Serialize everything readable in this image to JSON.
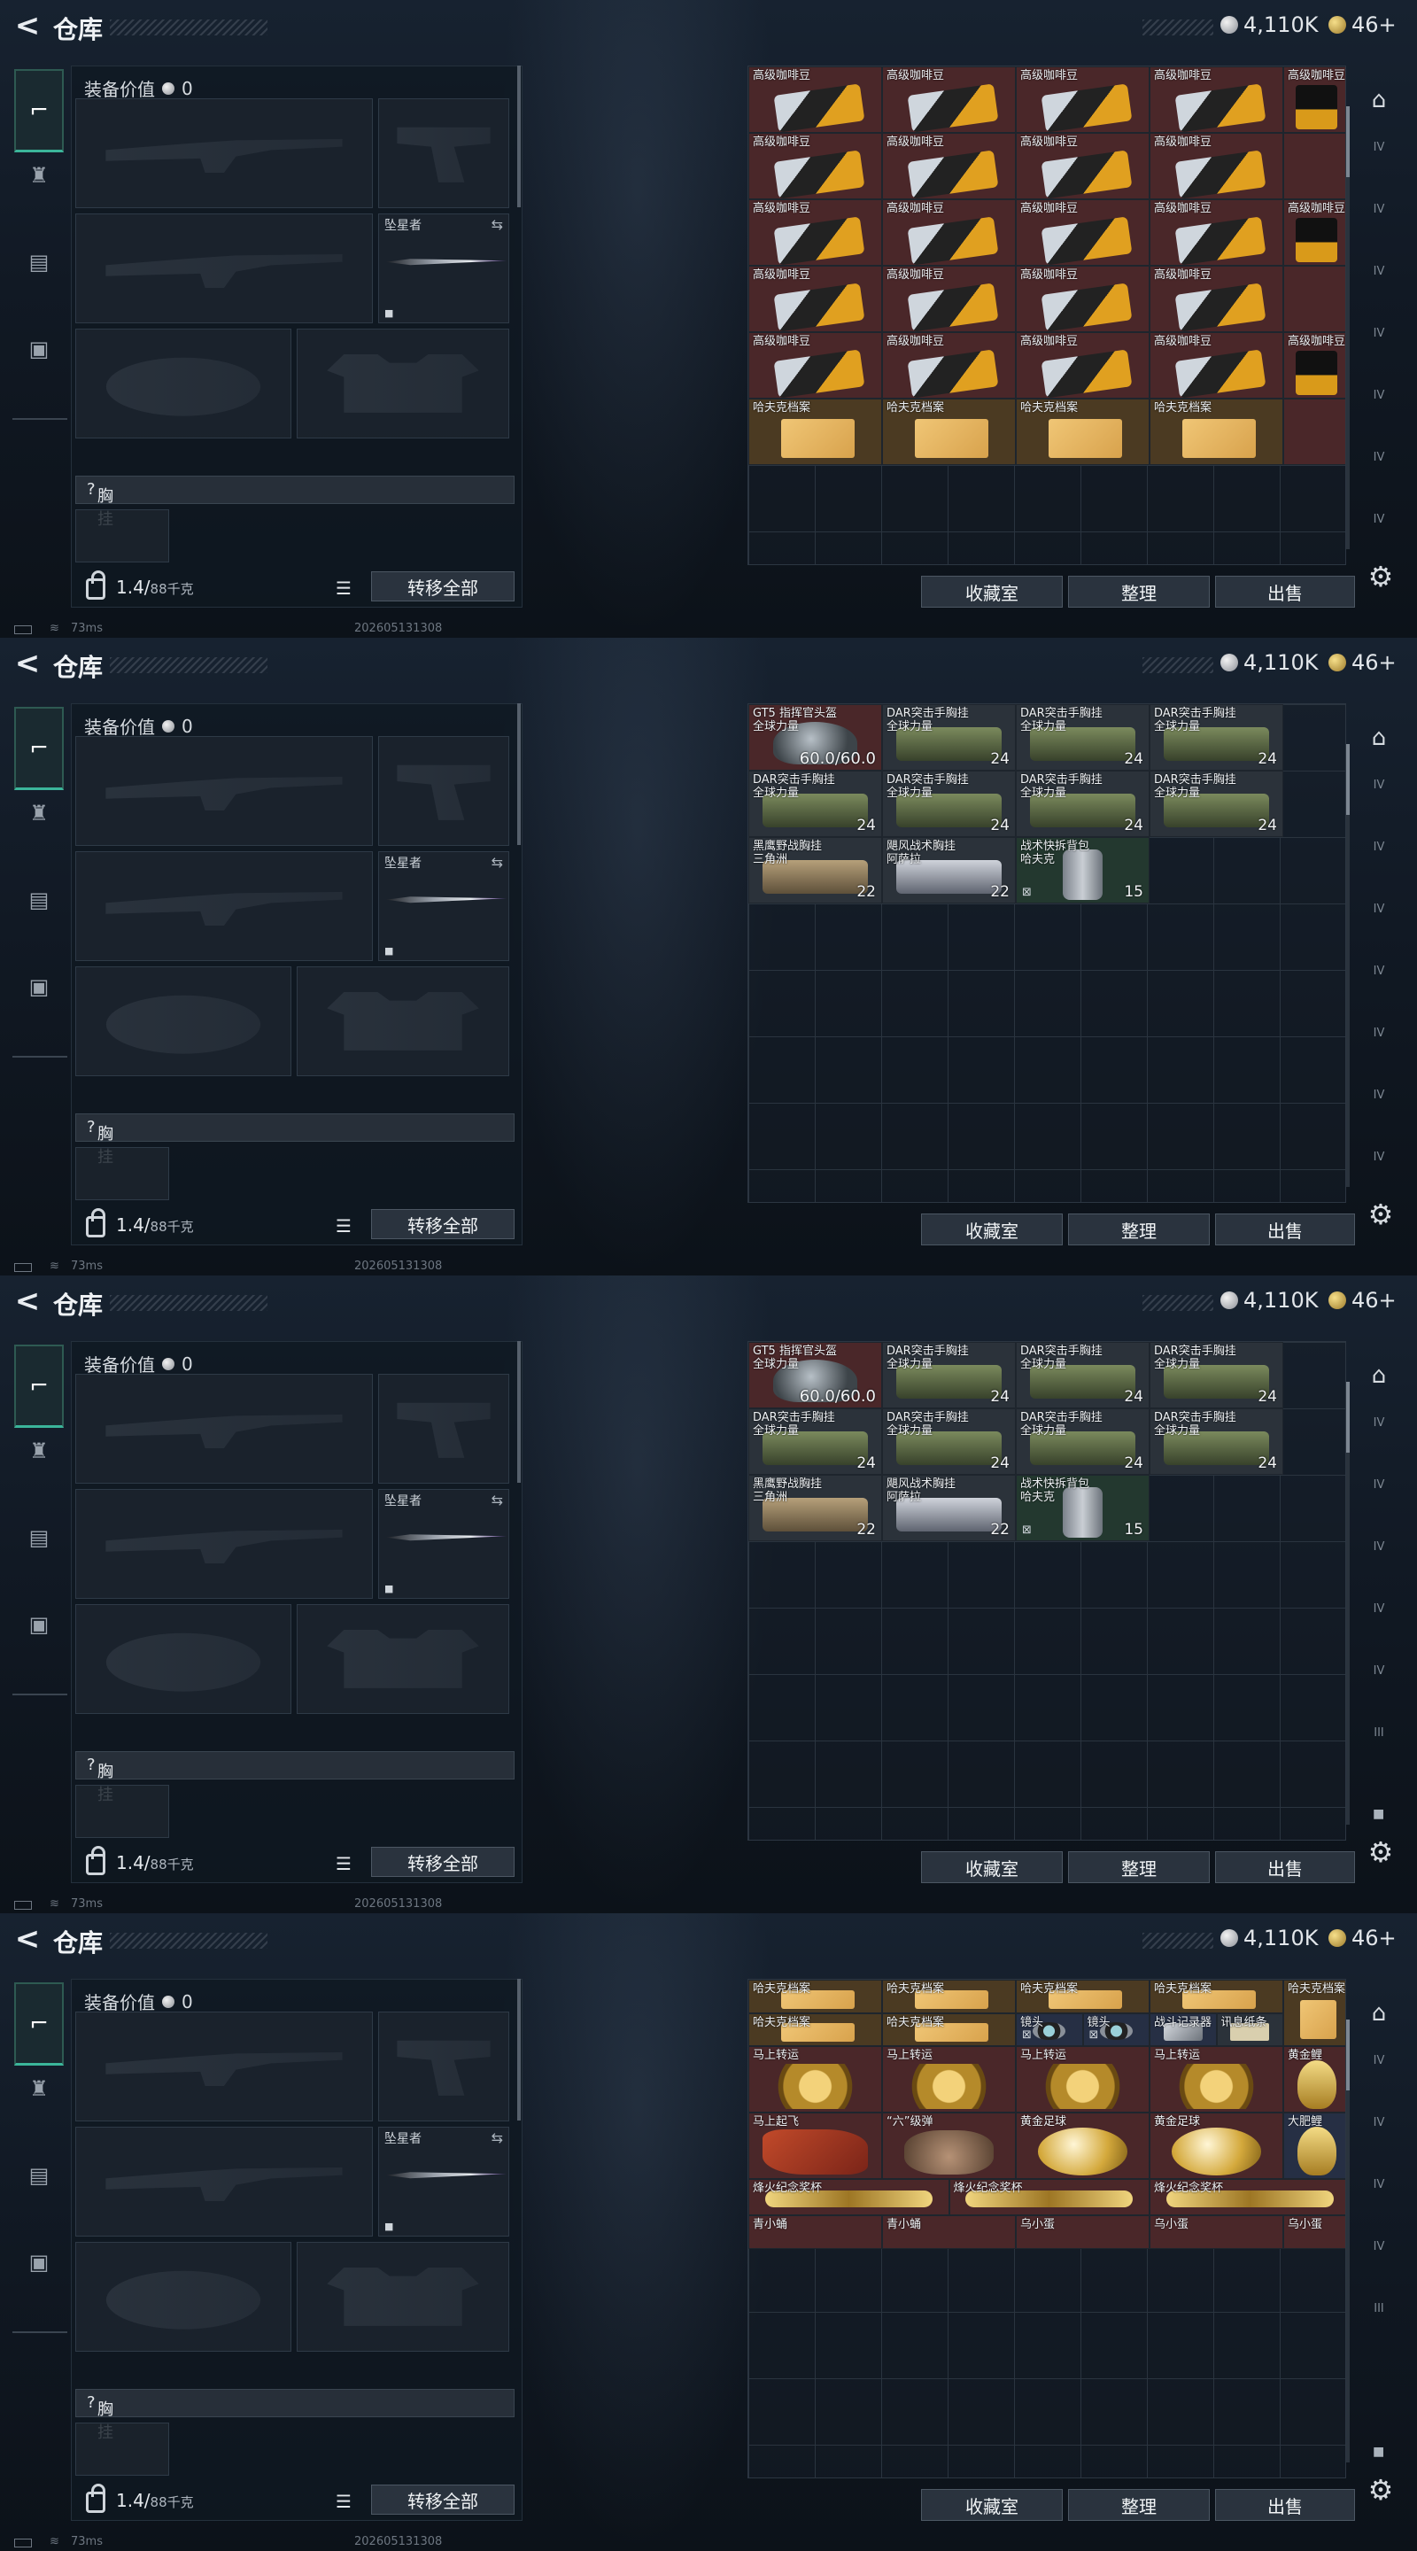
{
  "header": {
    "title": "仓库",
    "currency_silver": "4,110K",
    "currency_gold": "46+"
  },
  "left": {
    "equip_value_label": "装备价值",
    "equip_value": "0",
    "knife_name": "坠星者",
    "chest_label": "胸挂",
    "chest_help": "?",
    "weight_value": "1.4/",
    "weight_cap": "88千克",
    "transfer_all": "转移全部"
  },
  "buttons": {
    "collection": "收藏室",
    "organize": "整理",
    "sell": "出售"
  },
  "status": {
    "ping": "73ms",
    "datetime": "202605131308"
  },
  "right_rail": {
    "tabs": [
      "IV",
      "IV",
      "IV",
      "IV",
      "IV",
      "IV",
      "IV"
    ],
    "tabs_screen3": [
      "IV",
      "IV",
      "IV",
      "IV",
      "IV",
      "III"
    ],
    "tabs_screen4": [
      "IV",
      "IV",
      "IV",
      "IV",
      "III"
    ]
  },
  "screens": [
    {
      "cells": [
        {
          "c": 0,
          "r": -1,
          "w": 1,
          "h": 1,
          "bg": "bg-red",
          "name": "",
          "pic": "coffee"
        },
        {
          "c": 1,
          "r": -1,
          "w": 1,
          "h": 1,
          "bg": "bg-red",
          "name": "",
          "pic": "coffee"
        },
        {
          "c": 2,
          "r": -1,
          "w": 1,
          "h": 1,
          "bg": "bg-red",
          "name": "",
          "pic": "coffee"
        },
        {
          "c": 3,
          "r": -1,
          "w": 1,
          "h": 1,
          "bg": "bg-red",
          "name": "",
          "pic": "coffee"
        },
        {
          "c": 4,
          "r": -1,
          "w": 1,
          "h": 1,
          "bg": "bg-red",
          "name": "",
          "pic": "coffee"
        },
        {
          "c": 0,
          "r": 0,
          "w": 1,
          "h": 1,
          "bg": "bg-red",
          "name": "高级咖啡豆",
          "pic": "coffee"
        },
        {
          "c": 1,
          "r": 0,
          "w": 1,
          "h": 1,
          "bg": "bg-red",
          "name": "高级咖啡豆",
          "pic": "coffee"
        },
        {
          "c": 2,
          "r": 0,
          "w": 1,
          "h": 1,
          "bg": "bg-red",
          "name": "高级咖啡豆",
          "pic": "coffee"
        },
        {
          "c": 3,
          "r": 0,
          "w": 1,
          "h": 1,
          "bg": "bg-red",
          "name": "高级咖啡豆",
          "pic": "coffee"
        },
        {
          "c": 4,
          "r": 0,
          "w": 0.5,
          "h": 1,
          "bg": "bg-red",
          "name": "高级咖啡豆",
          "pic": "bag"
        },
        {
          "c": 0,
          "r": 1,
          "w": 1,
          "h": 1,
          "bg": "bg-red",
          "name": "高级咖啡豆",
          "pic": "coffee"
        },
        {
          "c": 1,
          "r": 1,
          "w": 1,
          "h": 1,
          "bg": "bg-red",
          "name": "高级咖啡豆",
          "pic": "coffee"
        },
        {
          "c": 2,
          "r": 1,
          "w": 1,
          "h": 1,
          "bg": "bg-red",
          "name": "高级咖啡豆",
          "pic": "coffee"
        },
        {
          "c": 3,
          "r": 1,
          "w": 1,
          "h": 1,
          "bg": "bg-red",
          "name": "高级咖啡豆",
          "pic": "coffee"
        },
        {
          "c": 4,
          "r": 1,
          "w": 0.5,
          "h": 1,
          "bg": "bg-red",
          "name": "",
          "pic": ""
        },
        {
          "c": 0,
          "r": 2,
          "w": 1,
          "h": 1,
          "bg": "bg-red",
          "name": "高级咖啡豆",
          "pic": "coffee"
        },
        {
          "c": 1,
          "r": 2,
          "w": 1,
          "h": 1,
          "bg": "bg-red",
          "name": "高级咖啡豆",
          "pic": "coffee"
        },
        {
          "c": 2,
          "r": 2,
          "w": 1,
          "h": 1,
          "bg": "bg-red",
          "name": "高级咖啡豆",
          "pic": "coffee"
        },
        {
          "c": 3,
          "r": 2,
          "w": 1,
          "h": 1,
          "bg": "bg-red",
          "name": "高级咖啡豆",
          "pic": "coffee"
        },
        {
          "c": 4,
          "r": 2,
          "w": 0.5,
          "h": 1,
          "bg": "bg-red",
          "name": "高级咖啡豆",
          "pic": "bag"
        },
        {
          "c": 0,
          "r": 3,
          "w": 1,
          "h": 1,
          "bg": "bg-red",
          "name": "高级咖啡豆",
          "pic": "coffee"
        },
        {
          "c": 1,
          "r": 3,
          "w": 1,
          "h": 1,
          "bg": "bg-red",
          "name": "高级咖啡豆",
          "pic": "coffee"
        },
        {
          "c": 2,
          "r": 3,
          "w": 1,
          "h": 1,
          "bg": "bg-red",
          "name": "高级咖啡豆",
          "pic": "coffee"
        },
        {
          "c": 3,
          "r": 3,
          "w": 1,
          "h": 1,
          "bg": "bg-red",
          "name": "高级咖啡豆",
          "pic": "coffee"
        },
        {
          "c": 4,
          "r": 3,
          "w": 0.5,
          "h": 1,
          "bg": "bg-red",
          "name": "",
          "pic": ""
        },
        {
          "c": 0,
          "r": 4,
          "w": 1,
          "h": 1,
          "bg": "bg-red",
          "name": "高级咖啡豆",
          "pic": "coffee"
        },
        {
          "c": 1,
          "r": 4,
          "w": 1,
          "h": 1,
          "bg": "bg-red",
          "name": "高级咖啡豆",
          "pic": "coffee"
        },
        {
          "c": 2,
          "r": 4,
          "w": 1,
          "h": 1,
          "bg": "bg-red",
          "name": "高级咖啡豆",
          "pic": "coffee"
        },
        {
          "c": 3,
          "r": 4,
          "w": 1,
          "h": 1,
          "bg": "bg-red",
          "name": "高级咖啡豆",
          "pic": "coffee"
        },
        {
          "c": 4,
          "r": 4,
          "w": 0.5,
          "h": 1,
          "bg": "bg-red",
          "name": "高级咖啡豆",
          "pic": "bag"
        },
        {
          "c": 0,
          "r": 5,
          "w": 1,
          "h": 1,
          "bg": "bg-gold",
          "name": "哈夫克档案",
          "pic": "paper"
        },
        {
          "c": 1,
          "r": 5,
          "w": 1,
          "h": 1,
          "bg": "bg-gold",
          "name": "哈夫克档案",
          "pic": "paper"
        },
        {
          "c": 2,
          "r": 5,
          "w": 1,
          "h": 1,
          "bg": "bg-gold",
          "name": "哈夫克档案",
          "pic": "paper"
        },
        {
          "c": 3,
          "r": 5,
          "w": 1,
          "h": 1,
          "bg": "bg-gold",
          "name": "哈夫克档案",
          "pic": "paper"
        },
        {
          "c": 4,
          "r": 5,
          "w": 0.5,
          "h": 1,
          "bg": "bg-red",
          "name": "",
          "pic": ""
        }
      ]
    },
    {
      "cells": [
        {
          "c": 0,
          "r": 0,
          "w": 1,
          "h": 1,
          "bg": "bg-red",
          "name": "GT5 指挥官头盔\n全球力量",
          "dura": "60.0/60.0",
          "pic": "helmet"
        },
        {
          "c": 1,
          "r": 0,
          "w": 1,
          "h": 1,
          "bg": "bg-gray",
          "name": "DAR突击手胸挂\n全球力量",
          "cnt": "24",
          "pic": "rig"
        },
        {
          "c": 2,
          "r": 0,
          "w": 1,
          "h": 1,
          "bg": "bg-gray",
          "name": "DAR突击手胸挂\n全球力量",
          "cnt": "24",
          "pic": "rig"
        },
        {
          "c": 3,
          "r": 0,
          "w": 1,
          "h": 1,
          "bg": "bg-gray",
          "name": "DAR突击手胸挂\n全球力量",
          "cnt": "24",
          "pic": "rig"
        },
        {
          "c": 0,
          "r": 1,
          "w": 1,
          "h": 1,
          "bg": "bg-gray",
          "name": "DAR突击手胸挂\n全球力量",
          "cnt": "24",
          "pic": "rig"
        },
        {
          "c": 1,
          "r": 1,
          "w": 1,
          "h": 1,
          "bg": "bg-gray",
          "name": "DAR突击手胸挂\n全球力量",
          "cnt": "24",
          "pic": "rig"
        },
        {
          "c": 2,
          "r": 1,
          "w": 1,
          "h": 1,
          "bg": "bg-gray",
          "name": "DAR突击手胸挂\n全球力量",
          "cnt": "24",
          "pic": "rig"
        },
        {
          "c": 3,
          "r": 1,
          "w": 1,
          "h": 1,
          "bg": "bg-gray",
          "name": "DAR突击手胸挂\n全球力量",
          "cnt": "24",
          "pic": "rig"
        },
        {
          "c": 0,
          "r": 2,
          "w": 1,
          "h": 1,
          "bg": "bg-gray",
          "name": "黑鹰野战胸挂\n三角洲",
          "cnt": "22",
          "pic": "rigtan"
        },
        {
          "c": 1,
          "r": 2,
          "w": 1,
          "h": 1,
          "bg": "bg-gray",
          "name": "飓风战术胸挂\n阿萨拉",
          "cnt": "22",
          "pic": "riggray"
        },
        {
          "c": 2,
          "r": 2,
          "w": 1,
          "h": 1,
          "bg": "bg-green",
          "name": "战术快拆背包\n哈夫克",
          "cnt": "15",
          "pic": "pack",
          "bl": "⊠"
        }
      ]
    },
    {
      "cells": [
        {
          "c": 0,
          "r": 0,
          "w": 1,
          "h": 1,
          "bg": "bg-red",
          "name": "GT5 指挥官头盔\n全球力量",
          "dura": "60.0/60.0",
          "pic": "helmet"
        },
        {
          "c": 1,
          "r": 0,
          "w": 1,
          "h": 1,
          "bg": "bg-gray",
          "name": "DAR突击手胸挂\n全球力量",
          "cnt": "24",
          "pic": "rig"
        },
        {
          "c": 2,
          "r": 0,
          "w": 1,
          "h": 1,
          "bg": "bg-gray",
          "name": "DAR突击手胸挂\n全球力量",
          "cnt": "24",
          "pic": "rig"
        },
        {
          "c": 3,
          "r": 0,
          "w": 1,
          "h": 1,
          "bg": "bg-gray",
          "name": "DAR突击手胸挂\n全球力量",
          "cnt": "24",
          "pic": "rig"
        },
        {
          "c": 0,
          "r": 1,
          "w": 1,
          "h": 1,
          "bg": "bg-gray",
          "name": "DAR突击手胸挂\n全球力量",
          "cnt": "24",
          "pic": "rig"
        },
        {
          "c": 1,
          "r": 1,
          "w": 1,
          "h": 1,
          "bg": "bg-gray",
          "name": "DAR突击手胸挂\n全球力量",
          "cnt": "24",
          "pic": "rig"
        },
        {
          "c": 2,
          "r": 1,
          "w": 1,
          "h": 1,
          "bg": "bg-gray",
          "name": "DAR突击手胸挂\n全球力量",
          "cnt": "24",
          "pic": "rig"
        },
        {
          "c": 3,
          "r": 1,
          "w": 1,
          "h": 1,
          "bg": "bg-gray",
          "name": "DAR突击手胸挂\n全球力量",
          "cnt": "24",
          "pic": "rig"
        },
        {
          "c": 0,
          "r": 2,
          "w": 1,
          "h": 1,
          "bg": "bg-gray",
          "name": "黑鹰野战胸挂\n三角洲",
          "cnt": "22",
          "pic": "rigtan"
        },
        {
          "c": 1,
          "r": 2,
          "w": 1,
          "h": 1,
          "bg": "bg-gray",
          "name": "飓风战术胸挂\n阿萨拉",
          "cnt": "22",
          "pic": "riggray"
        },
        {
          "c": 2,
          "r": 2,
          "w": 1,
          "h": 1,
          "bg": "bg-green",
          "name": "战术快拆背包\n哈夫克",
          "cnt": "15",
          "pic": "pack",
          "bl": "⊠"
        }
      ]
    },
    {
      "cells": [
        {
          "c": 0,
          "r": 0,
          "w": 1,
          "h": 0.5,
          "bg": "bg-gold",
          "name": "哈夫克档案",
          "pic": "paper"
        },
        {
          "c": 1,
          "r": 0,
          "w": 1,
          "h": 0.5,
          "bg": "bg-gold",
          "name": "哈夫克档案",
          "pic": "paper"
        },
        {
          "c": 2,
          "r": 0,
          "w": 1,
          "h": 0.5,
          "bg": "bg-gold",
          "name": "哈夫克档案",
          "pic": "paper"
        },
        {
          "c": 3,
          "r": 0,
          "w": 1,
          "h": 0.5,
          "bg": "bg-gold",
          "name": "哈夫克档案",
          "pic": "paper"
        },
        {
          "c": 4,
          "r": 0,
          "w": 0.5,
          "h": 1,
          "bg": "bg-gold",
          "name": "哈夫克档案",
          "pic": "paper"
        },
        {
          "c": 0,
          "r": 0.5,
          "w": 1,
          "h": 0.5,
          "bg": "bg-gold",
          "name": "哈夫克档案",
          "pic": "paper"
        },
        {
          "c": 1,
          "r": 0.5,
          "w": 1,
          "h": 0.5,
          "bg": "bg-gold",
          "name": "哈夫克档案",
          "pic": "paper"
        },
        {
          "c": 2,
          "r": 0.5,
          "w": 0.5,
          "h": 0.5,
          "bg": "bg-blue",
          "name": "镜头",
          "pic": "lens",
          "bl": "⊠"
        },
        {
          "c": 2.5,
          "r": 0.5,
          "w": 0.5,
          "h": 0.5,
          "bg": "bg-blue",
          "name": "镜头",
          "pic": "lens",
          "bl": "⊠"
        },
        {
          "c": 3,
          "r": 0.5,
          "w": 0.5,
          "h": 0.5,
          "bg": "bg-blue",
          "name": "战斗记录器",
          "pic": "box"
        },
        {
          "c": 3.5,
          "r": 0.5,
          "w": 0.5,
          "h": 0.5,
          "bg": "bg-gray",
          "name": "讯息纸条",
          "pic": "note"
        },
        {
          "c": 0,
          "r": 1,
          "w": 1,
          "h": 1,
          "bg": "bg-red",
          "name": "马上转运",
          "pic": "medal"
        },
        {
          "c": 1,
          "r": 1,
          "w": 1,
          "h": 1,
          "bg": "bg-red",
          "name": "马上转运",
          "pic": "medal"
        },
        {
          "c": 2,
          "r": 1,
          "w": 1,
          "h": 1,
          "bg": "bg-red",
          "name": "马上转运",
          "pic": "medal"
        },
        {
          "c": 3,
          "r": 1,
          "w": 1,
          "h": 1,
          "bg": "bg-red",
          "name": "马上转运",
          "pic": "medal"
        },
        {
          "c": 4,
          "r": 1,
          "w": 0.5,
          "h": 1,
          "bg": "bg-red",
          "name": "黄金鲤",
          "pic": "fish"
        },
        {
          "c": 0,
          "r": 2,
          "w": 1,
          "h": 1,
          "bg": "bg-red",
          "name": "马上起飞",
          "pic": "horse"
        },
        {
          "c": 1,
          "r": 2,
          "w": 1,
          "h": 1,
          "bg": "bg-red",
          "name": "“六”级弹",
          "pic": "hand"
        },
        {
          "c": 2,
          "r": 2,
          "w": 1,
          "h": 1,
          "bg": "bg-red",
          "name": "黄金足球",
          "pic": "ball"
        },
        {
          "c": 3,
          "r": 2,
          "w": 1,
          "h": 1,
          "bg": "bg-red",
          "name": "黄金足球",
          "pic": "ball"
        },
        {
          "c": 4,
          "r": 2,
          "w": 0.5,
          "h": 1,
          "bg": "bg-blue",
          "name": "大肥鲤",
          "pic": "fish"
        },
        {
          "c": 0,
          "r": 3,
          "w": 1.5,
          "h": 0.55,
          "bg": "bg-red",
          "name": "烽火纪念奖杯",
          "pic": "trophy"
        },
        {
          "c": 1.5,
          "r": 3,
          "w": 1.5,
          "h": 0.55,
          "bg": "bg-red",
          "name": "烽火纪念奖杯",
          "pic": "trophy"
        },
        {
          "c": 3,
          "r": 3,
          "w": 1.5,
          "h": 0.55,
          "bg": "bg-red",
          "name": "烽火纪念奖杯",
          "pic": "trophy"
        },
        {
          "c": 0,
          "r": 3.55,
          "w": 1,
          "h": 0.5,
          "bg": "bg-red",
          "name": "青小蛹",
          "pic": ""
        },
        {
          "c": 1,
          "r": 3.55,
          "w": 1,
          "h": 0.5,
          "bg": "bg-red",
          "name": "青小蛹",
          "pic": ""
        },
        {
          "c": 2,
          "r": 3.55,
          "w": 1,
          "h": 0.5,
          "bg": "bg-red",
          "name": "乌小蛋",
          "pic": ""
        },
        {
          "c": 3,
          "r": 3.55,
          "w": 1,
          "h": 0.5,
          "bg": "bg-red",
          "name": "乌小蛋",
          "pic": ""
        },
        {
          "c": 4,
          "r": 3.55,
          "w": 0.5,
          "h": 0.5,
          "bg": "bg-red",
          "name": "乌小蛋",
          "pic": ""
        }
      ]
    }
  ]
}
